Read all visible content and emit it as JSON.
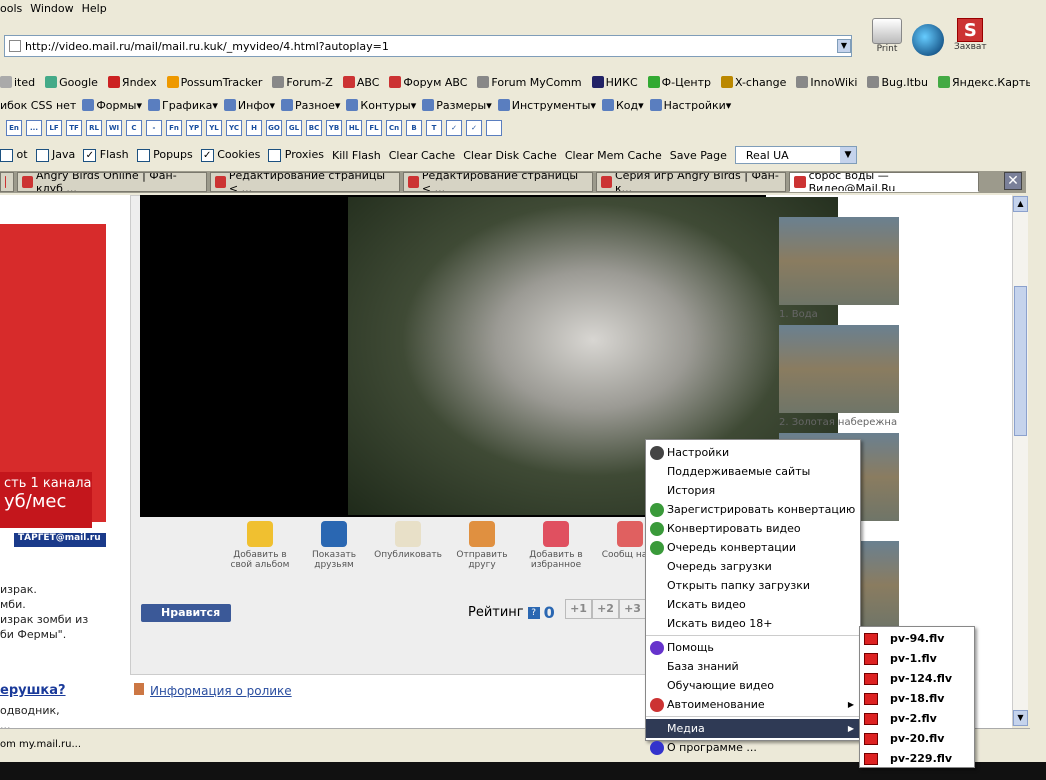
{
  "menu": {
    "tools": "ools",
    "window": "Window",
    "help": "Help"
  },
  "address": {
    "url": "http://video.mail.ru/mail/mail.ru.kuk/_myvideo/4.html?autoplay=1"
  },
  "right_buttons": {
    "print": "Print",
    "capture": "Захват"
  },
  "bookmarks": [
    "ited",
    "Google",
    "Яndex",
    "PossumTracker",
    "Forum-Z",
    "ABC",
    "Форум ABC",
    "Forum MyComm",
    "НИКС",
    "Ф-Центр",
    "X-change",
    "InnoWiki",
    "Bug.Itbu",
    "Яндекс.Карты"
  ],
  "webdev": [
    "ибок CSS нет",
    "Формы",
    "Графика",
    "Инфо",
    "Разное",
    "Контуры",
    "Размеры",
    "Инструменты",
    "Код",
    "Настройки"
  ],
  "tb3_buttons": [
    "En",
    "...",
    "LF",
    "TF",
    "RL",
    "WI",
    "C",
    "-",
    "Fn",
    "YP",
    "YL",
    "YC",
    "H",
    "GO",
    "GL",
    "BC",
    "YB",
    "HL",
    "FL",
    "Cn",
    "B",
    "T",
    "✓",
    "✓",
    ""
  ],
  "ff": {
    "items": [
      {
        "label": "ot",
        "check": false
      },
      {
        "label": "Java",
        "check": false
      },
      {
        "label": "Flash",
        "check": true
      },
      {
        "label": "Popups",
        "check": false
      },
      {
        "label": "Cookies",
        "check": true
      },
      {
        "label": "Proxies",
        "check": false
      }
    ],
    "buttons": [
      "Kill Flash",
      "Clear Cache",
      "Clear Disk Cache",
      "Clear Mem Cache",
      "Save Page"
    ],
    "select": "Real UA"
  },
  "tabs": [
    {
      "label": "",
      "active": false
    },
    {
      "label": "Angry Birds Online | Фан-клуб ...",
      "active": false
    },
    {
      "label": "Редактирование страницы < ...",
      "active": false
    },
    {
      "label": "Редактирование страницы < ...",
      "active": false
    },
    {
      "label": "Серия игр Angry Birds | Фан-к...",
      "active": false
    },
    {
      "label": "сброс воды — Видео@Mail.Ru",
      "active": true
    }
  ],
  "ad": {
    "line1": "сть 1 канала",
    "line2": "уб/мес",
    "target": "ТАРГЕТ@mail.ru"
  },
  "left_text": [
    "израк.",
    "мби.",
    "израк зомби из",
    "би Фермы\"."
  ],
  "left_link": "ерушка?",
  "left_text2": [
    "одводник,",
    "..."
  ],
  "actions": [
    {
      "label": "Добавить в свой альбом",
      "color": "#f0c030"
    },
    {
      "label": "Показать друзьям",
      "color": "#2a67b2"
    },
    {
      "label": "Опубликовать",
      "color": "#e8e0c8"
    },
    {
      "label": "Отправить другу",
      "color": "#e09040"
    },
    {
      "label": "Добавить в избранное",
      "color": "#e05060"
    },
    {
      "label": "Сообщ нару",
      "color": "#e06060"
    }
  ],
  "like": "Нравится",
  "rating": {
    "label": "Рейтинг",
    "q": "?",
    "value": "0",
    "buttons": [
      "+1",
      "+2",
      "+3"
    ]
  },
  "info_link": "Информация о ролике",
  "side": [
    {
      "caption": "1. Вода"
    },
    {
      "caption": "2. Золотая набережна"
    },
    {
      "caption": "й. Сб"
    },
    {
      "caption": ""
    }
  ],
  "status": {
    "text": "om my.mail.ru..."
  },
  "context_menu": [
    {
      "label": "Настройки",
      "icon": "#444"
    },
    {
      "label": "Поддерживаемые сайты",
      "icon": ""
    },
    {
      "label": "История",
      "icon": ""
    },
    {
      "label": "Зарегистрировать конвертацию",
      "icon": "#3a9a3a"
    },
    {
      "label": "Конвертировать видео",
      "icon": "#3a9a3a"
    },
    {
      "label": "Очередь конвертации",
      "icon": "#3a9a3a"
    },
    {
      "label": "Очередь загрузки",
      "icon": ""
    },
    {
      "label": "Открыть папку загрузки",
      "icon": ""
    },
    {
      "label": "Искать видео",
      "icon": ""
    },
    {
      "label": "Искать видео 18+",
      "icon": ""
    },
    {
      "label": "Помощь",
      "icon": "#6633cc"
    },
    {
      "label": "База знаний",
      "icon": ""
    },
    {
      "label": "Обучающие видео",
      "icon": ""
    },
    {
      "label": "Автоименование",
      "icon": "#cc3333"
    },
    {
      "label": "Медиа",
      "icon": ""
    },
    {
      "label": "О программе ...",
      "icon": "#3333cc"
    }
  ],
  "media_submenu": [
    "pv-94.flv",
    "pv-1.flv",
    "pv-124.flv",
    "pv-18.flv",
    "pv-2.flv",
    "pv-20.flv",
    "pv-229.flv"
  ]
}
